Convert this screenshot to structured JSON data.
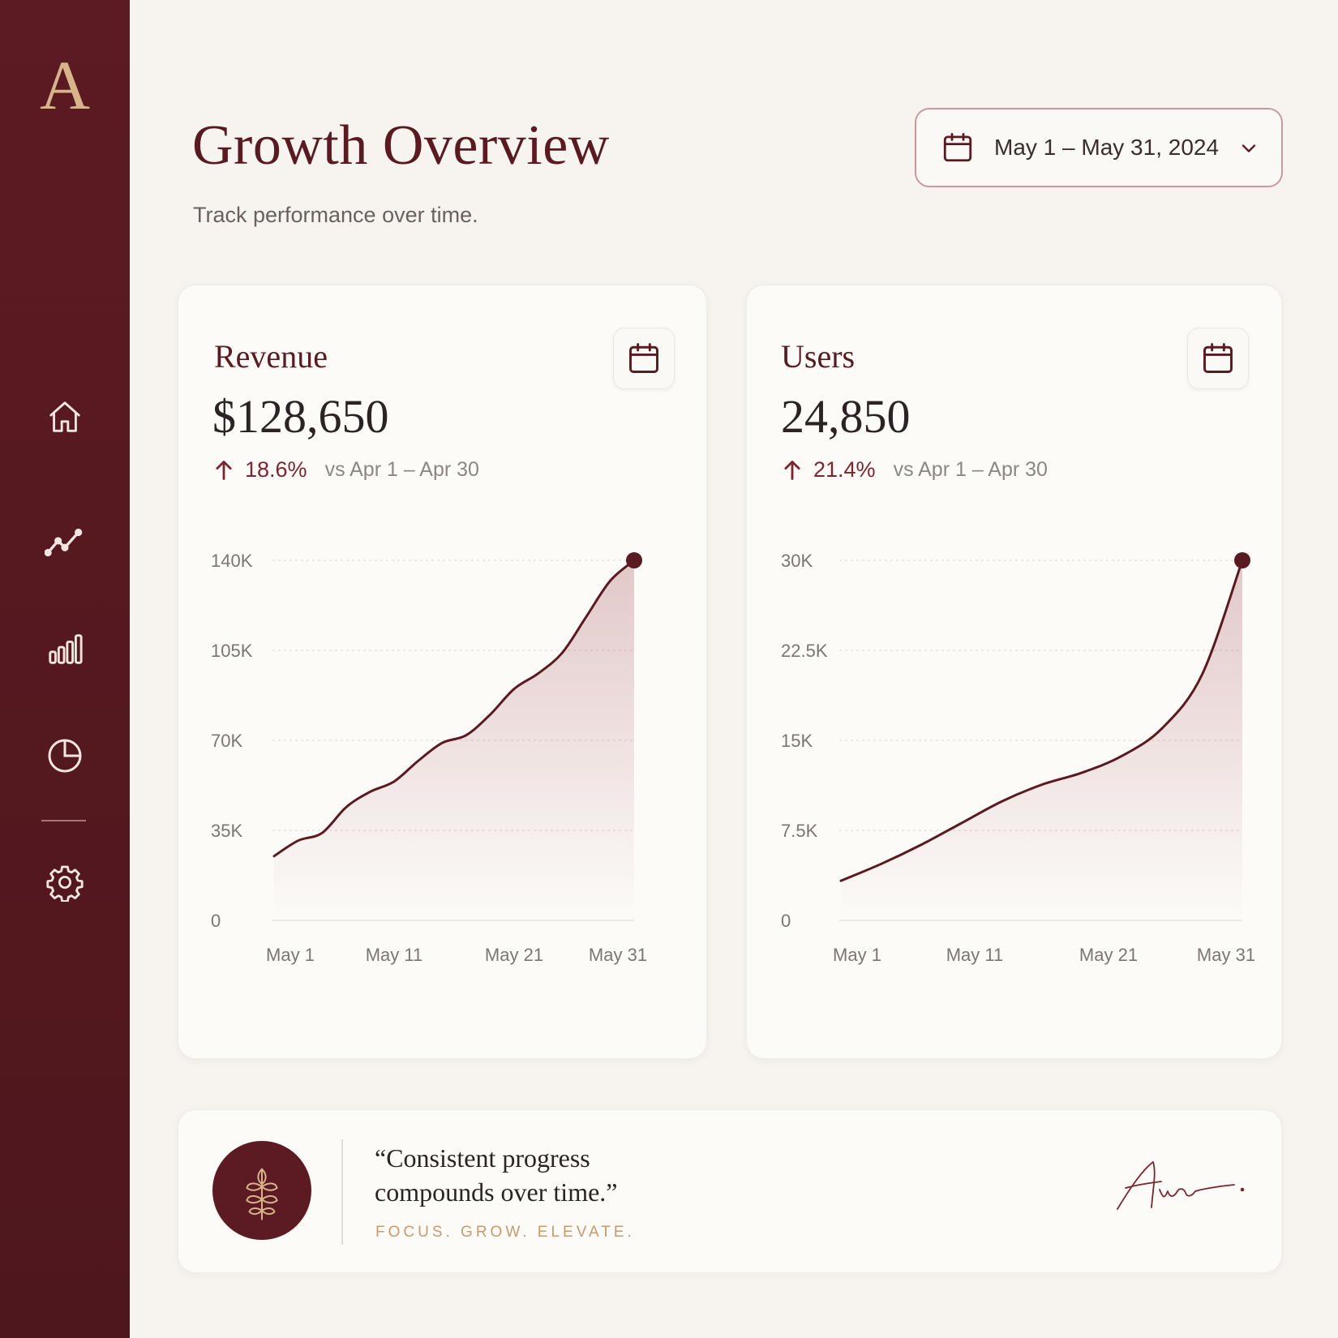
{
  "app": {
    "logo_letter": "A"
  },
  "sidebar": {
    "items": [
      {
        "name": "home",
        "icon": "home-icon"
      },
      {
        "name": "growth",
        "icon": "trend-line-icon"
      },
      {
        "name": "reports",
        "icon": "bar-chart-icon"
      },
      {
        "name": "breakdown",
        "icon": "pie-chart-icon"
      },
      {
        "name": "settings",
        "icon": "gear-icon"
      }
    ]
  },
  "header": {
    "title": "Growth Overview",
    "subtitle": "Track performance over time.",
    "date_range": "May 1 – May 31, 2024"
  },
  "colors": {
    "accent": "#5a1a22",
    "sidebar_bg": "#5c1a22",
    "gold": "#d8b48a",
    "background": "#f7f4ef"
  },
  "cards": {
    "revenue": {
      "title": "Revenue",
      "value": "$128,650",
      "change": "18.6%",
      "comparison": "vs Apr 1 – Apr 30"
    },
    "users": {
      "title": "Users",
      "value": "24,850",
      "change": "21.4%",
      "comparison": "vs Apr 1 – Apr 30"
    }
  },
  "chart_data": [
    {
      "type": "area",
      "y_ticks": [
        "0",
        "35K",
        "70K",
        "105K",
        "140K"
      ],
      "ylim": [
        0,
        140000
      ],
      "x_ticks": [
        "May 1",
        "May 11",
        "May 21",
        "May 31"
      ],
      "x": [
        1,
        3,
        5,
        7,
        9,
        11,
        13,
        15,
        17,
        19,
        21,
        23,
        25,
        27,
        29,
        31
      ],
      "values": [
        25000,
        31000,
        34000,
        44000,
        50000,
        54000,
        62000,
        69000,
        72000,
        80000,
        90000,
        96000,
        104000,
        118000,
        132000,
        140000
      ],
      "grid": true
    },
    {
      "type": "area",
      "y_ticks": [
        "0",
        "7.5K",
        "15K",
        "22.5K",
        "30K"
      ],
      "ylim": [
        0,
        30000
      ],
      "x_ticks": [
        "May 1",
        "May 11",
        "May 21",
        "May 31"
      ],
      "x": [
        1,
        4,
        7,
        10,
        13,
        16,
        19,
        22,
        25,
        28,
        31
      ],
      "values": [
        3300,
        4700,
        6300,
        8100,
        9900,
        11300,
        12300,
        13700,
        16000,
        20500,
        30000
      ],
      "grid": true
    }
  ],
  "quote": {
    "text": "“Consistent progress compounds over time.”",
    "tagline": "FOCUS. GROW. ELEVATE.",
    "signature": "Ava",
    "badge_icon": "leaf-icon"
  }
}
